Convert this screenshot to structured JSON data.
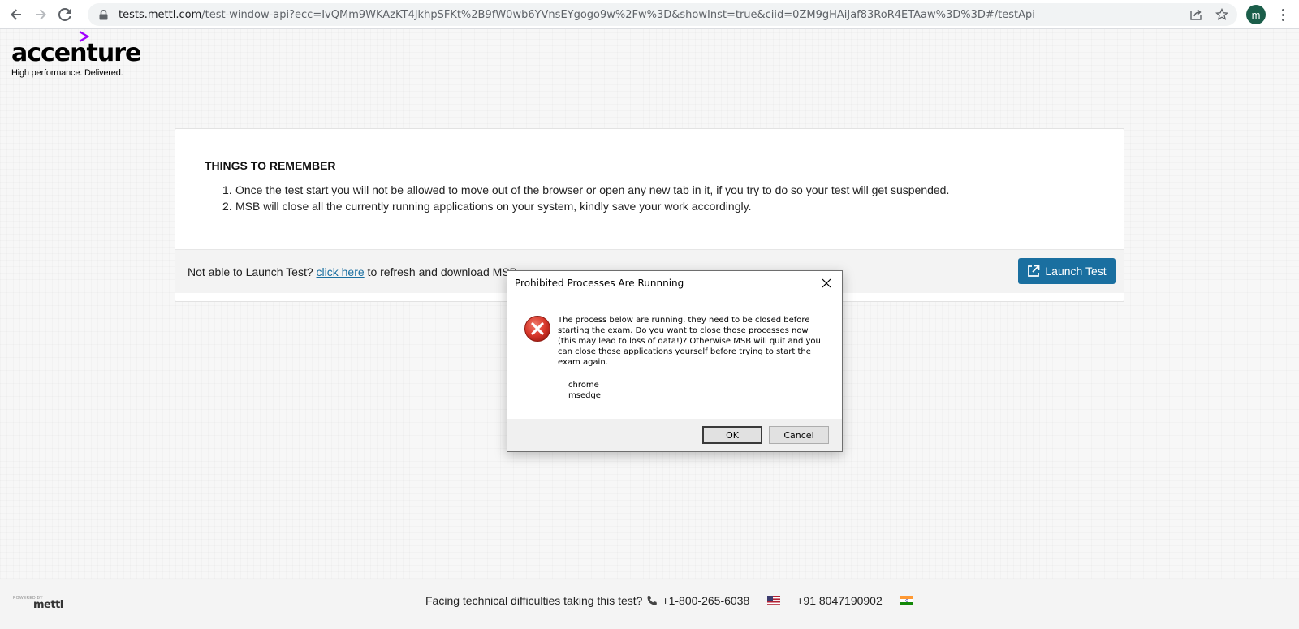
{
  "browser": {
    "url_host": "tests.mettl.com",
    "url_path": "/test-window-api?ecc=IvQMm9WKAzKT4JkhpSFKt%2B9fW0wb6YVnsEYgogo9w%2Fw%3D&showInst=true&ciid=0ZM9gHAiJaf83RoR4ETAaw%3D%3D#/testApi",
    "avatar_letter": "m",
    "back_icon": "arrow-left",
    "forward_icon": "arrow-right",
    "reload_icon": "reload",
    "lock_icon": "lock",
    "share_icon": "share",
    "bookmark_icon": "star"
  },
  "logo": {
    "word": "accenture",
    "tagline": "High performance. Delivered.",
    "accent_color": "#a100ff"
  },
  "card": {
    "title": "THINGS TO REMEMBER",
    "rules": [
      {
        "num": "1.",
        "text": "Once the test start you will not be allowed to move out of the browser or open any new tab in it, if you try to do so your test will get suspended."
      },
      {
        "num": "2.",
        "text": "MSB will close all the currently running applications on your system, kindly save your work accordingly."
      }
    ],
    "footer_prefix": "Not able to Launch Test? ",
    "footer_link": "click here",
    "footer_suffix": " to refresh and download MSB",
    "launch_label": "Launch Test",
    "launch_icon": "external-link",
    "launch_color": "#1a6fa0"
  },
  "dialog": {
    "title": "Prohibited Processes Are Runnning",
    "message": "The process below are running, they need to be closed before starting the exam. Do you want to close those processes now (this may lead to loss of data!)? Otherwise MSB will quit and you can close those applications yourself before trying to start the exam again.",
    "processes": [
      "chrome",
      "msedge"
    ],
    "ok_label": "OK",
    "cancel_label": "Cancel",
    "error_icon": "error-x",
    "error_color": "#c42b1c"
  },
  "bottom": {
    "powered_small": "POWERED BY",
    "powered_brand": "mettl",
    "help_text": "Facing technical difficulties taking this test?",
    "phone_us": "+1-800-265-6038",
    "phone_in": "+91 8047190902"
  }
}
